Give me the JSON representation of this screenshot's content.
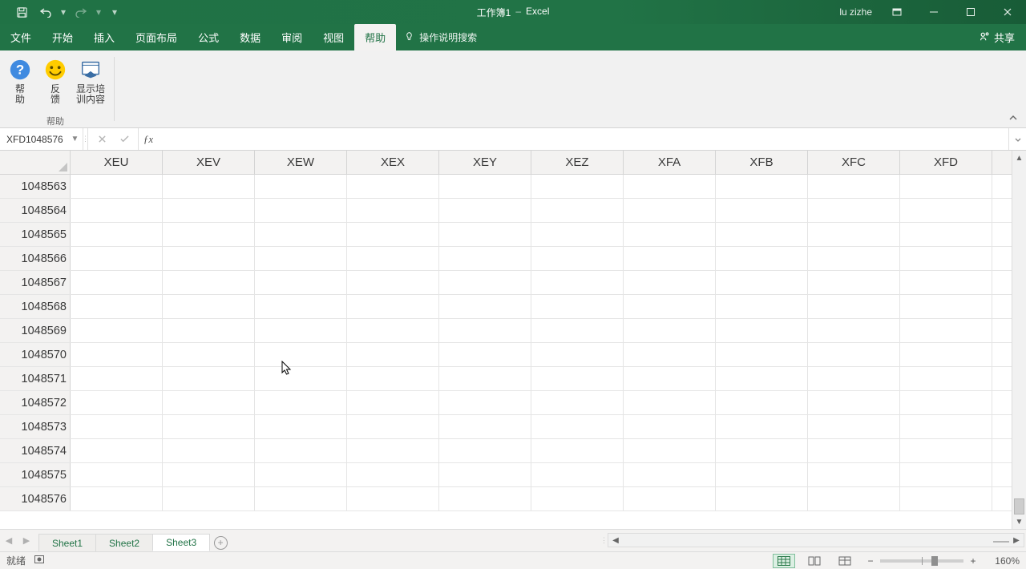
{
  "titlebar": {
    "doc_name": "工作簿1",
    "dash": "–",
    "app_name": "Excel",
    "user": "lu zizhe"
  },
  "ribbon_tabs": {
    "file": "文件",
    "home": "开始",
    "insert": "插入",
    "layout": "页面布局",
    "formula": "公式",
    "data": "数据",
    "review": "审阅",
    "view": "视图",
    "help": "帮助",
    "tellme": "操作说明搜索",
    "share": "共享"
  },
  "ribbon_help": {
    "help_btn": "帮\n助",
    "feedback_btn": "反\n馈",
    "training_btn": "显示培\n训内容",
    "group_label": "帮助"
  },
  "formula_bar": {
    "namebox": "XFD1048576",
    "fx_value": ""
  },
  "grid": {
    "columns": [
      "XEU",
      "XEV",
      "XEW",
      "XEX",
      "XEY",
      "XEZ",
      "XFA",
      "XFB",
      "XFC",
      "XFD"
    ],
    "rows": [
      "1048563",
      "1048564",
      "1048565",
      "1048566",
      "1048567",
      "1048568",
      "1048569",
      "1048570",
      "1048571",
      "1048572",
      "1048573",
      "1048574",
      "1048575",
      "1048576"
    ]
  },
  "sheets": {
    "tabs": [
      "Sheet1",
      "Sheet2",
      "Sheet3"
    ],
    "active_index": 2
  },
  "status": {
    "ready": "就绪",
    "zoom_pct": "160%"
  }
}
